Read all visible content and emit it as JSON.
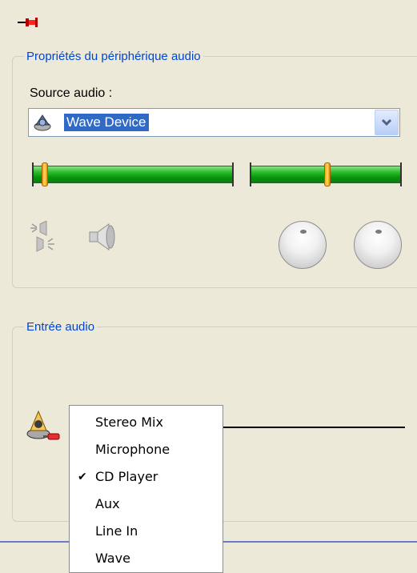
{
  "device_group": {
    "title": "Propriétés du périphérique audio",
    "source_label": "Source audio :",
    "source_value": "Wave Device"
  },
  "volume": {
    "left_level": 0.05,
    "right_level": 0.51
  },
  "icons": {
    "pin": "pushpin-icon",
    "balance": "speaker-balance-icon",
    "speaker": "speaker-volume-icon",
    "source_device": "speaker-cd-icon",
    "input_device": "microphone-speaker-icon"
  },
  "input_group": {
    "title": "Entrée audio"
  },
  "input_menu": {
    "items": [
      {
        "label": "Stereo Mix",
        "checked": false
      },
      {
        "label": "Microphone",
        "checked": false
      },
      {
        "label": "CD Player",
        "checked": true
      },
      {
        "label": "Aux",
        "checked": false
      },
      {
        "label": "Line In",
        "checked": false
      },
      {
        "label": "Wave",
        "checked": false
      }
    ],
    "check_glyph": "✔"
  },
  "colors": {
    "background": "#ece9d8",
    "group_title": "#0046d5",
    "selection": "#316ac5",
    "slider_green": "#07930a",
    "thumb_orange": "#f5a400"
  }
}
